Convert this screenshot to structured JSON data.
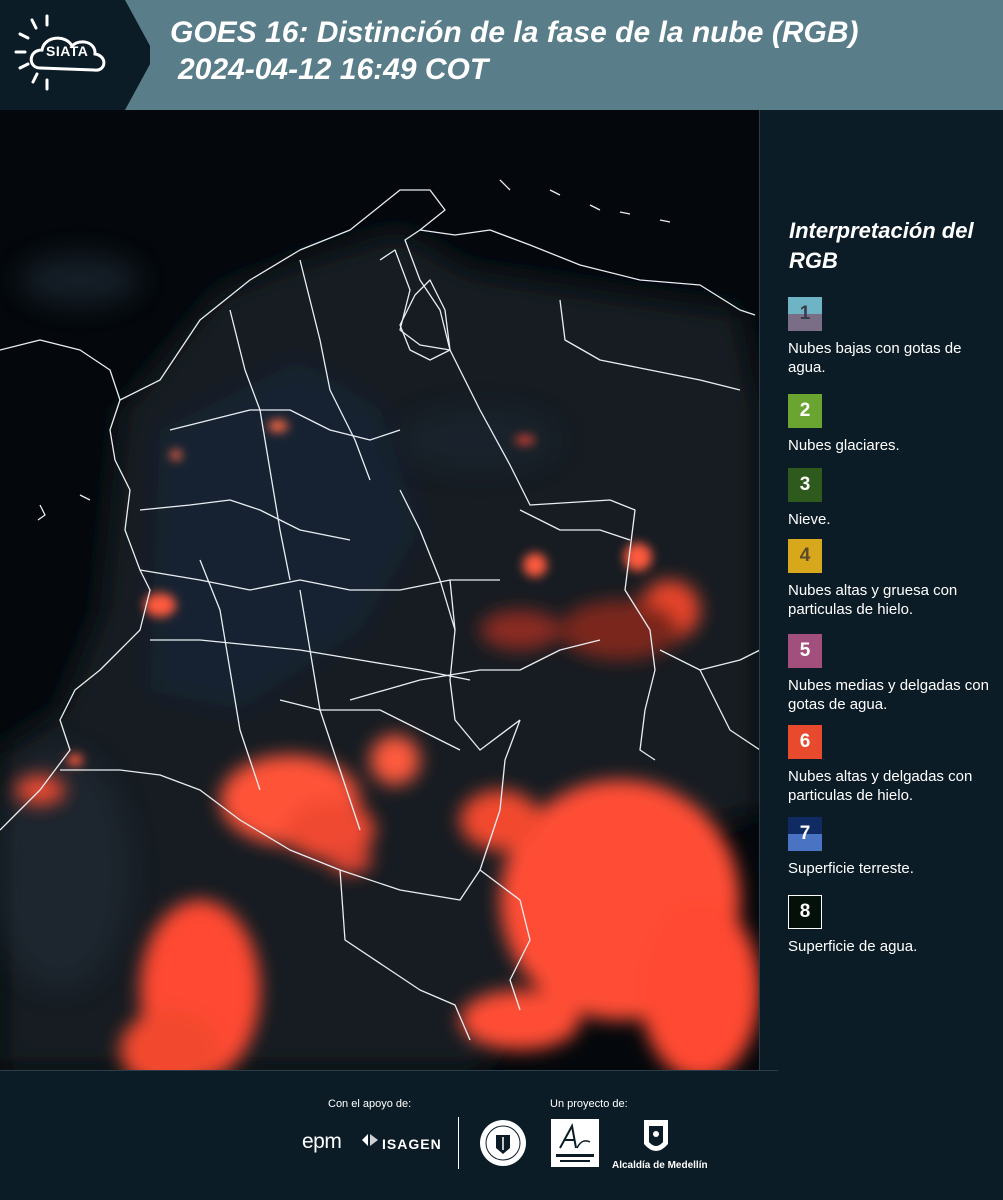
{
  "header": {
    "logo_text": "SIATA",
    "title_line1": "GOES 16: Distinción de la fase de la nube (RGB)",
    "title_line2": "2024-04-12 16:49 COT",
    "background_color": "#5a7d8a"
  },
  "legend": {
    "title": "Interpretación del RGB",
    "items": [
      {
        "number": "1",
        "label": "Nubes bajas con gotas de agua.",
        "colors": [
          "#6fb4c4",
          "#7a6d86"
        ]
      },
      {
        "number": "2",
        "label": "Nubes glaciares.",
        "colors": [
          "#6aa531"
        ]
      },
      {
        "number": "3",
        "label": "Nieve.",
        "colors": [
          "#2f5a1d"
        ]
      },
      {
        "number": "4",
        "label": "Nubes altas y gruesa con particulas de hielo.",
        "colors": [
          "#d8a81c"
        ]
      },
      {
        "number": "5",
        "label": "Nubes medias y delgadas con gotas de agua.",
        "colors": [
          "#a34f7d"
        ]
      },
      {
        "number": "6",
        "label": "Nubes altas y delgadas con particulas de hielo.",
        "colors": [
          "#e84a2d"
        ]
      },
      {
        "number": "7",
        "label": "Superficie terreste.",
        "colors": [
          "#102a63",
          "#4b73c3"
        ]
      },
      {
        "number": "8",
        "label": "Superficie de agua.",
        "colors": [
          "#04100a"
        ]
      }
    ]
  },
  "footer": {
    "support_caption": "Con el apoyo de:",
    "project_caption": "Un proyecto de:",
    "sponsors": [
      "epm",
      "ISAGEN"
    ],
    "partners": [
      "Área Metropolitana Valle de Aburrá",
      "Alcaldía de Medellín"
    ],
    "epm_text": "epm",
    "isagen_text": "ISAGEN",
    "alcaldia_text": "Alcaldía de Medellín"
  }
}
